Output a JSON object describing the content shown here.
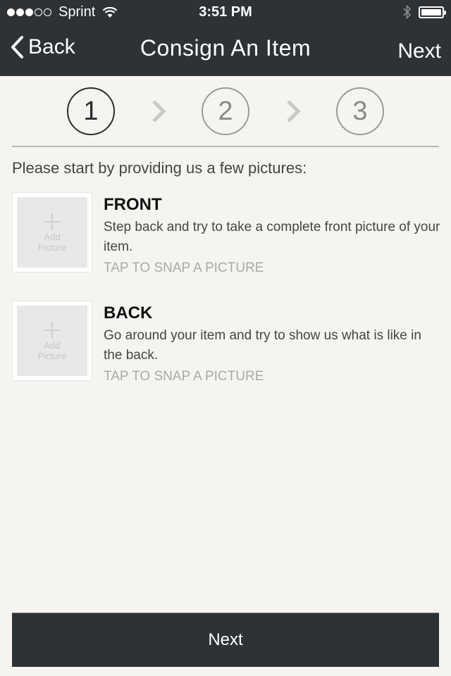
{
  "status_bar": {
    "signal_bars_filled": 3,
    "signal_bars_total": 5,
    "carrier": "Sprint",
    "time": "3:51 PM",
    "battery_level": 1.0
  },
  "nav": {
    "back_label": "Back",
    "title": "Consign An Item",
    "next_label": "Next"
  },
  "steps": {
    "items": [
      "1",
      "2",
      "3"
    ],
    "active_index": 0
  },
  "intro": "Please start by providing us a few pictures:",
  "items": [
    {
      "heading": "FRONT",
      "description": "Step back and try to take a complete front picture of your item.",
      "cta": "TAP TO SNAP A PICTURE",
      "thumb_label": "Add Picture"
    },
    {
      "heading": "BACK",
      "description": "Go around your item and try to show us what is like in the back.",
      "cta": "TAP TO SNAP A PICTURE",
      "thumb_label": "Add Picture"
    }
  ],
  "footer": {
    "next_label": "Next"
  }
}
